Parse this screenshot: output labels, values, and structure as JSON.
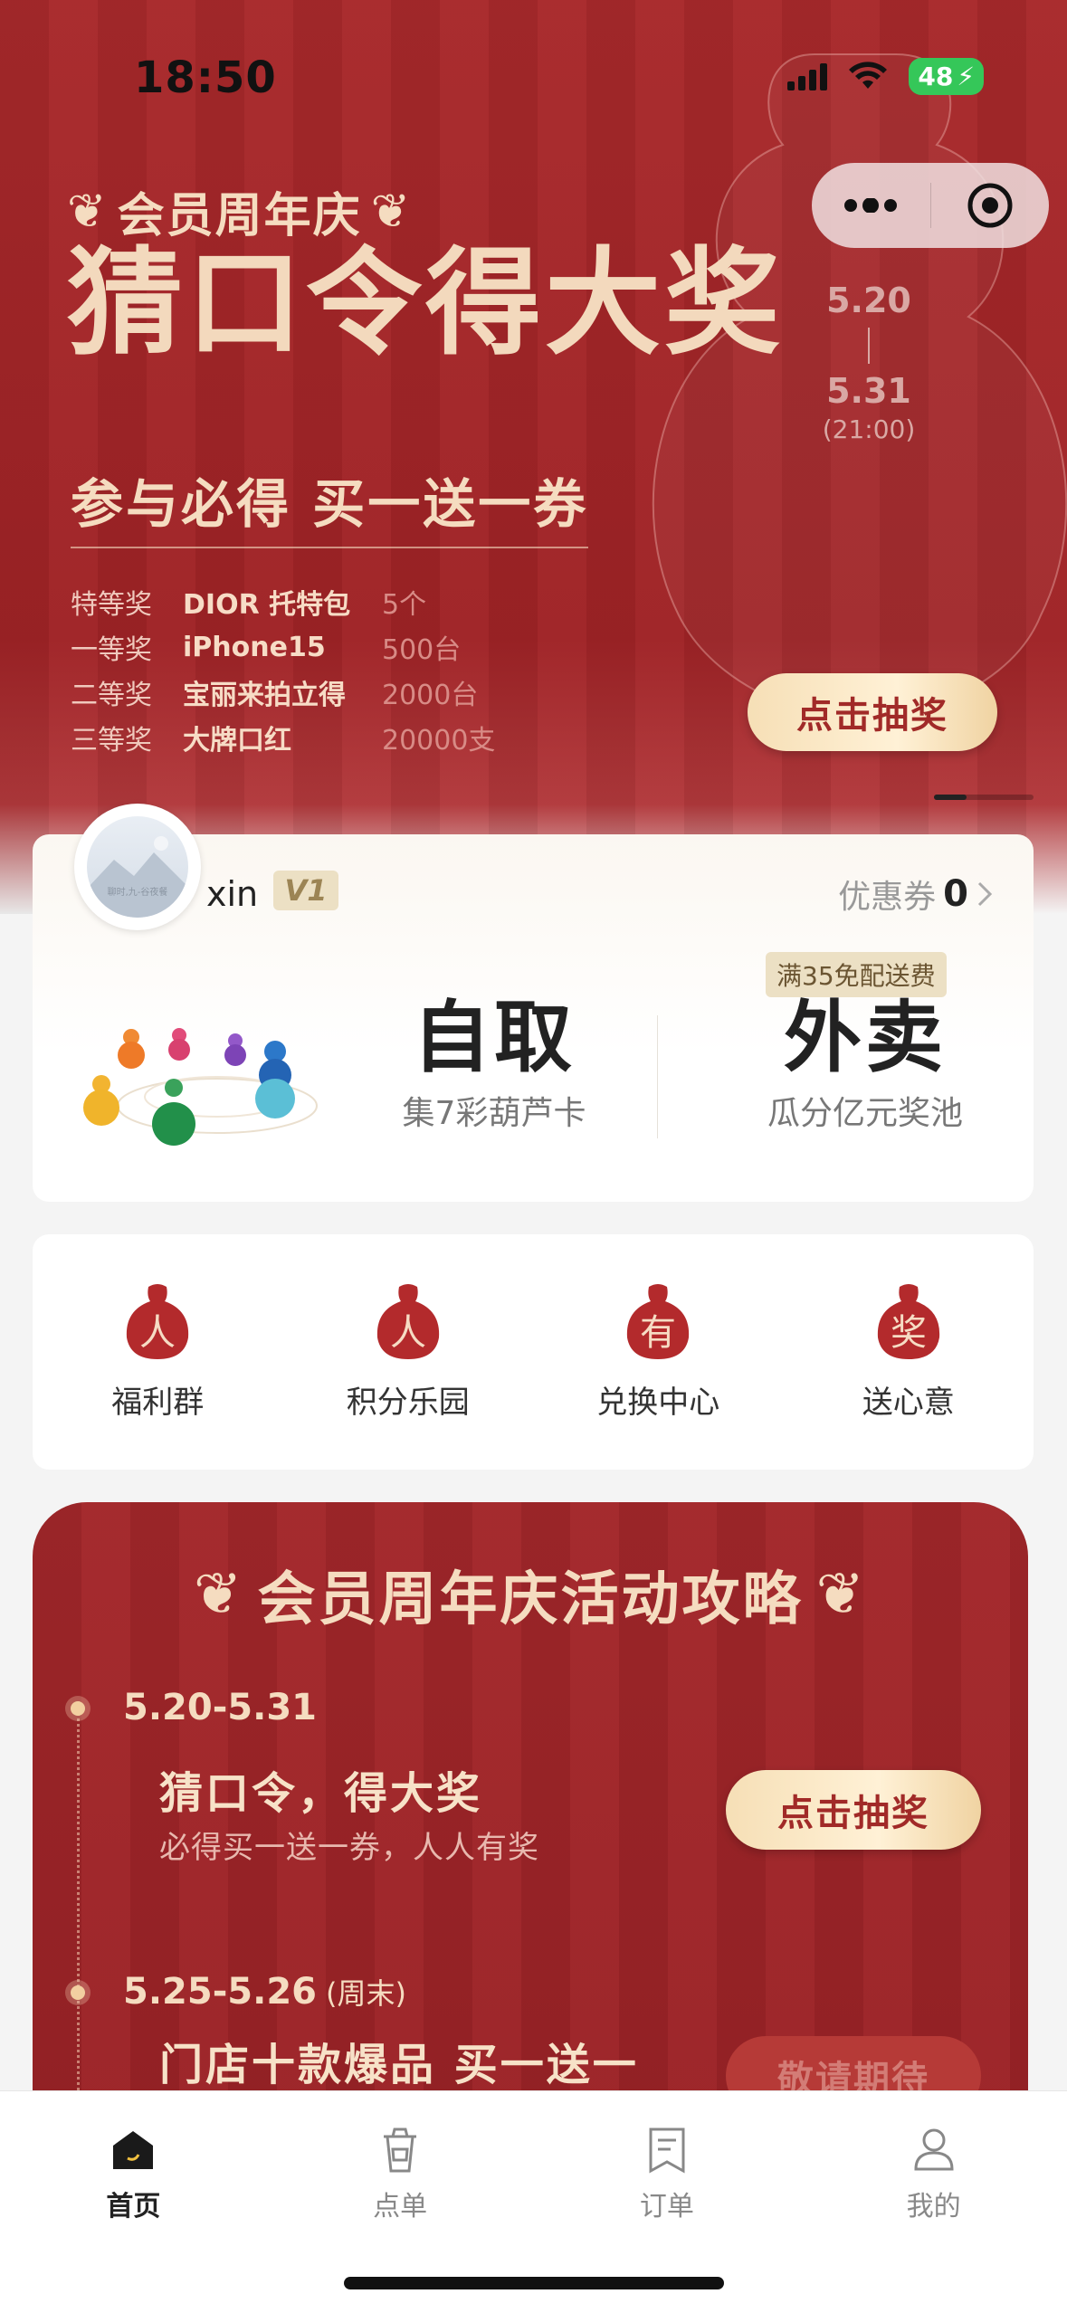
{
  "status_bar": {
    "time": "18:50",
    "battery": "48"
  },
  "hero": {
    "subtitle": "会员周年庆",
    "title": "猜口令得大奖",
    "date_start": "5.20",
    "date_end": "5.31",
    "date_time": "(21:00)",
    "tagline": "参与必得  买一送一券",
    "prizes": [
      {
        "level": "特等奖",
        "name": "DIOR 托特包",
        "qty": "5个"
      },
      {
        "level": "一等奖",
        "name": "iPhone15",
        "qty": "500台"
      },
      {
        "level": "二等奖",
        "name": "宝丽来拍立得",
        "qty": "2000台"
      },
      {
        "level": "三等奖",
        "name": "大牌口红",
        "qty": "20000支"
      }
    ],
    "draw_button": "点击抽奖"
  },
  "member": {
    "avatar_caption": "聊时,九-谷夜餐",
    "username": "xin",
    "level": "V1",
    "coupon_label": "优惠券",
    "coupon_count": "0",
    "pickup_title": "自取",
    "pickup_desc": "集7彩葫芦卡",
    "delivery_tag": "满35免配送费",
    "delivery_title": "外卖",
    "delivery_desc": "瓜分亿元奖池"
  },
  "quick_actions": [
    {
      "glyph": "人",
      "label": "福利群"
    },
    {
      "glyph": "人",
      "label": "积分乐园"
    },
    {
      "glyph": "有",
      "label": "兑换中心"
    },
    {
      "glyph": "奖",
      "label": "送心意"
    }
  ],
  "guide": {
    "title": "会员周年庆活动攻略",
    "items": [
      {
        "date": "5.20-5.31",
        "weekday": "",
        "title": "猜口令，得大奖",
        "desc": "必得买一送一券，人人有奖",
        "button": "点击抽奖"
      },
      {
        "date": "5.25-5.26",
        "weekday": "(周末)",
        "title": "门店十款爆品 买一送一",
        "desc": "",
        "button": "敬请期待"
      }
    ]
  },
  "tabs": [
    {
      "label": "首页",
      "icon": "home-icon",
      "active": true
    },
    {
      "label": "点单",
      "icon": "cup-icon",
      "active": false
    },
    {
      "label": "订单",
      "icon": "receipt-icon",
      "active": false
    },
    {
      "label": "我的",
      "icon": "profile-icon",
      "active": false
    }
  ],
  "colors": {
    "brand_red": "#a3272a",
    "gold": "#f5dcc0",
    "active_green": "#35c759"
  }
}
